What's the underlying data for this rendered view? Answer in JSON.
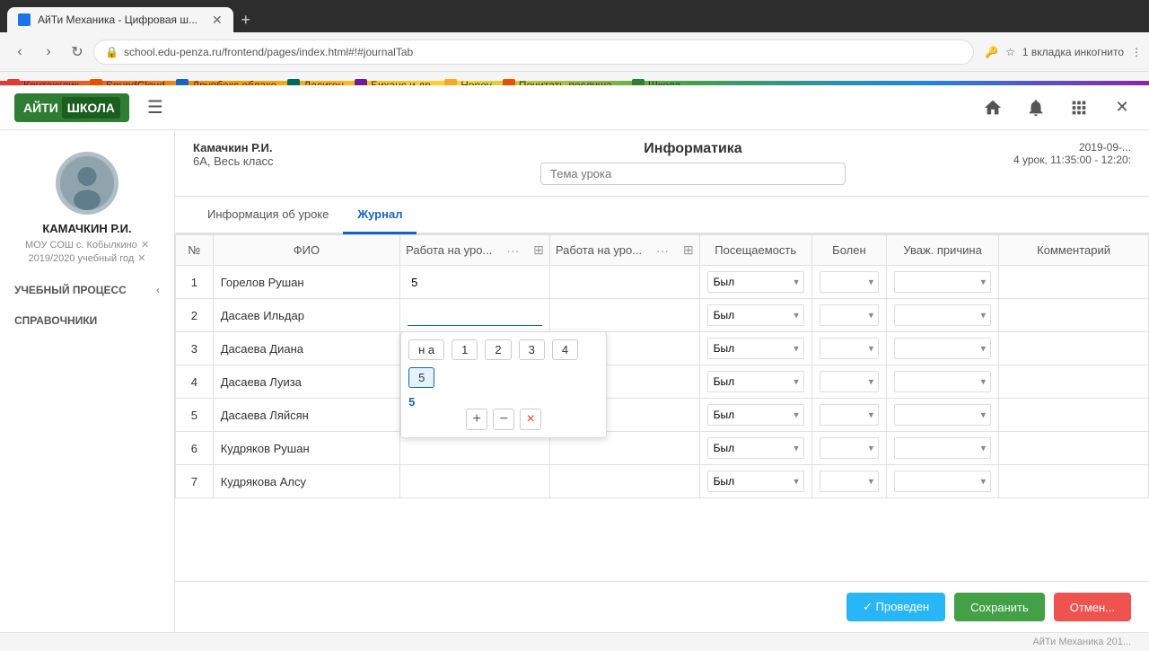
{
  "browser": {
    "tab_title": "АйТи Механика - Цифровая ш...",
    "url": "school.edu-penza.ru/frontend/pages/index.html#!#journalTab",
    "new_tab_label": "+",
    "incognito_label": "1 вкладка инкогнито"
  },
  "bookmarks": [
    {
      "id": "kontaklik",
      "label": "Контакклик",
      "color": "bk-red"
    },
    {
      "id": "soundcloud",
      "label": "SoundCloud",
      "color": "bk-orange"
    },
    {
      "id": "dropbox",
      "label": "Друпбокс облако",
      "color": "bk-blue"
    },
    {
      "id": "desigon",
      "label": "Десигон",
      "color": "bk-teal"
    },
    {
      "id": "behance",
      "label": "Биханс и др.",
      "color": "bk-purple"
    },
    {
      "id": "honey",
      "label": "Honey",
      "color": "bk-yellow"
    },
    {
      "id": "read",
      "label": "Почитать-послуша...",
      "color": "bk-orange"
    },
    {
      "id": "school",
      "label": "Школа",
      "color": "bk-green"
    }
  ],
  "app": {
    "logo_text": "АЙТИ",
    "logo_school": "ШКОЛА"
  },
  "sidebar": {
    "user": {
      "name": "КАМАЧКИН Р.И.",
      "school": "МОУ СОШ с. Кобылкино",
      "year": "2019/2020 учебный год"
    },
    "sections": [
      {
        "id": "teaching",
        "label": "УЧЕБНЫЙ ПРОЦЕСС"
      },
      {
        "id": "handbooks",
        "label": "СПРАВОЧНИКИ"
      }
    ]
  },
  "lesson": {
    "teacher": "Камачкин Р.И.",
    "class": "6А, Весь класс",
    "subject": "Информатика",
    "topic_placeholder": "Тема урока",
    "date": "2019-09-...",
    "lesson_num": "4 урок, 11:35:00 - 12:20:"
  },
  "tabs": [
    {
      "id": "info",
      "label": "Информация об уроке"
    },
    {
      "id": "journal",
      "label": "Журнал"
    }
  ],
  "table": {
    "columns": [
      {
        "id": "num",
        "label": "№"
      },
      {
        "id": "name",
        "label": "ФИО"
      },
      {
        "id": "work1",
        "label": "Работа на уро..."
      },
      {
        "id": "work2",
        "label": "Работа на уро..."
      },
      {
        "id": "attend",
        "label": "Посещаемость"
      },
      {
        "id": "sick",
        "label": "Болен"
      },
      {
        "id": "reason",
        "label": "Уваж. причина"
      },
      {
        "id": "comment",
        "label": "Комментарий"
      }
    ],
    "rows": [
      {
        "num": "1",
        "name": "Горелов Рушан",
        "work1": "5",
        "work2": "",
        "attend": "Был",
        "sick": "",
        "reason": "",
        "comment": ""
      },
      {
        "num": "2",
        "name": "Дасаев Ильдар",
        "work1": "",
        "work2": "",
        "attend": "Был",
        "sick": "",
        "reason": "",
        "comment": ""
      },
      {
        "num": "3",
        "name": "Дасаева Диана",
        "work1": "",
        "work2": "",
        "attend": "Был",
        "sick": "",
        "reason": "",
        "comment": ""
      },
      {
        "num": "4",
        "name": "Дасаева Луиза",
        "work1": "",
        "work2": "",
        "attend": "Был",
        "sick": "",
        "reason": "",
        "comment": ""
      },
      {
        "num": "5",
        "name": "Дасаева Ляйсян",
        "work1": "",
        "work2": "",
        "attend": "Был",
        "sick": "",
        "reason": "",
        "comment": ""
      },
      {
        "num": "6",
        "name": "Кудряков Рушан",
        "work1": "",
        "work2": "",
        "attend": "Был",
        "sick": "",
        "reason": "",
        "comment": ""
      },
      {
        "num": "7",
        "name": "Кудрякова Алсу",
        "work1": "",
        "work2": "",
        "attend": "Был",
        "sick": "",
        "reason": "",
        "comment": ""
      }
    ]
  },
  "grade_popup": {
    "options": [
      "н а",
      "1",
      "2",
      "3",
      "4",
      "5"
    ],
    "current": "5",
    "actions": [
      "+",
      "−",
      "×"
    ]
  },
  "footer": {
    "conducted_label": "✓ Проведен",
    "save_label": "Сохранить",
    "cancel_label": "Отмен..."
  },
  "bottom_bar": {
    "text": "АйТи Механика 201..."
  }
}
